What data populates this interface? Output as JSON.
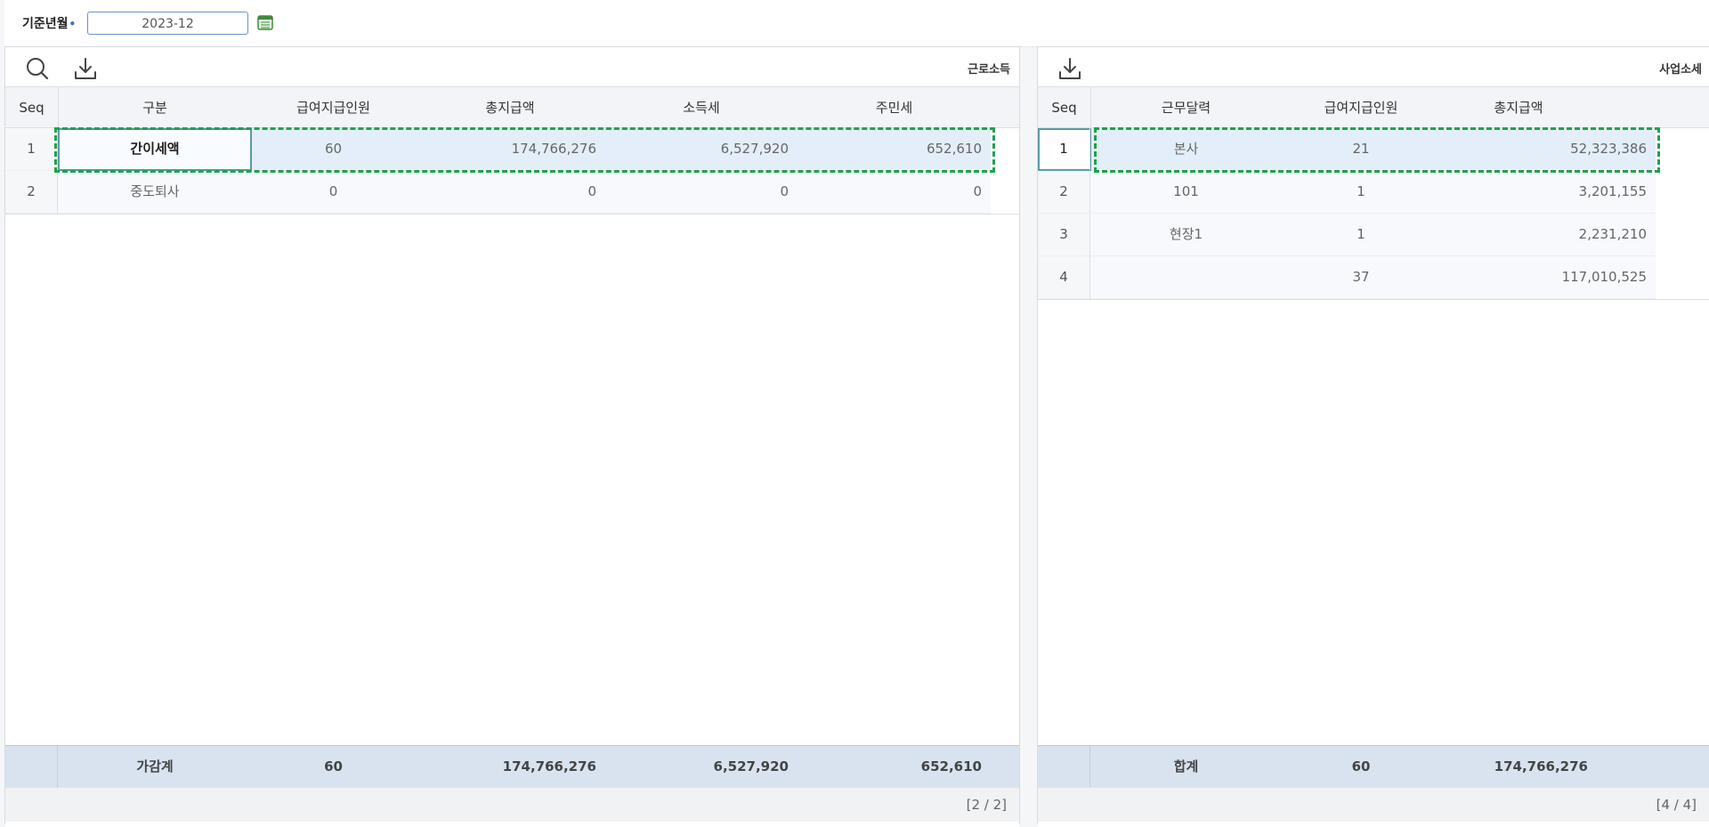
{
  "filter": {
    "label": "기준년월",
    "required_mark": "•",
    "value": "2023-12",
    "calendar_icon": "calendar-icon"
  },
  "left_panel": {
    "title": "근로소득",
    "icons": [
      "search-icon",
      "download-icon"
    ],
    "columns": [
      "Seq",
      "구분",
      "급여지급인원",
      "총지급액",
      "소득세",
      "주민세"
    ],
    "rows": [
      {
        "seq": "1",
        "category": "간이세액",
        "count": "60",
        "total": "174,766,276",
        "income_tax": "6,527,920",
        "resident_tax": "652,610"
      },
      {
        "seq": "2",
        "category": "중도퇴사",
        "count": "0",
        "total": "0",
        "income_tax": "0",
        "resident_tax": "0"
      }
    ],
    "footer": {
      "label": "가감계",
      "count": "60",
      "total": "174,766,276",
      "income_tax": "6,527,920",
      "resident_tax": "652,610"
    },
    "pager": "[2 / 2]"
  },
  "right_panel": {
    "title": "사업소세",
    "icons": [
      "download-icon"
    ],
    "columns": [
      "Seq",
      "근무달력",
      "급여지급인원",
      "총지급액"
    ],
    "rows": [
      {
        "seq": "1",
        "place": "본사",
        "count": "21",
        "total": "52,323,386"
      },
      {
        "seq": "2",
        "place": "101",
        "count": "1",
        "total": "3,201,155"
      },
      {
        "seq": "3",
        "place": "현장1",
        "count": "1",
        "total": "2,231,210"
      },
      {
        "seq": "4",
        "place": "",
        "count": "37",
        "total": "117,010,525"
      }
    ],
    "footer": {
      "label": "합계",
      "count": "60",
      "total": "174,766,276"
    },
    "pager": "[4 / 4]"
  },
  "colors": {
    "selection_dash": "#1ea24b",
    "selected_row": "#e3eef8",
    "footer_bg": "#d9e3f0",
    "header_bg": "#f2f4f7"
  }
}
